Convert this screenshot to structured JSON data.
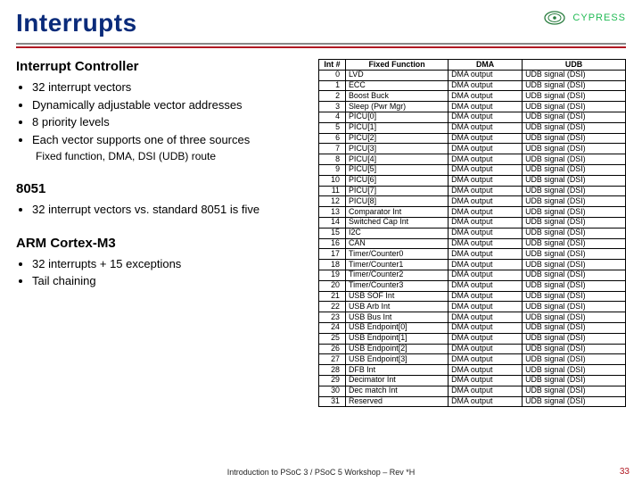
{
  "title": "Interrupts",
  "logo": {
    "company": "CYPRESS"
  },
  "sections": [
    {
      "heading": "Interrupt Controller",
      "bullets": [
        "32 interrupt vectors",
        "Dynamically adjustable vector addresses",
        "8 priority levels",
        "Each vector supports one of three sources"
      ],
      "sub": "Fixed function, DMA, DSI (UDB) route"
    },
    {
      "heading": "8051",
      "bullets": [
        "32 interrupt vectors vs. standard 8051 is five"
      ]
    },
    {
      "heading": "ARM Cortex-M3",
      "bullets": [
        "32 interrupts + 15 exceptions",
        "Tail chaining"
      ]
    }
  ],
  "table": {
    "headers": [
      "Int #",
      "Fixed Function",
      "DMA",
      "UDB"
    ],
    "rows": [
      [
        "0",
        "LVD",
        "DMA output",
        "UDB signal (DSI)"
      ],
      [
        "1",
        "ECC",
        "DMA output",
        "UDB signal (DSI)"
      ],
      [
        "2",
        "Boost Buck",
        "DMA output",
        "UDB signal (DSI)"
      ],
      [
        "3",
        "Sleep (Pwr Mgr)",
        "DMA output",
        "UDB signal (DSI)"
      ],
      [
        "4",
        "PICU[0]",
        "DMA output",
        "UDB signal (DSI)"
      ],
      [
        "5",
        "PICU[1]",
        "DMA output",
        "UDB signal (DSI)"
      ],
      [
        "6",
        "PICU[2]",
        "DMA output",
        "UDB signal (DSI)"
      ],
      [
        "7",
        "PICU[3]",
        "DMA output",
        "UDB signal (DSI)"
      ],
      [
        "8",
        "PICU[4]",
        "DMA output",
        "UDB signal (DSI)"
      ],
      [
        "9",
        "PICU[5]",
        "DMA output",
        "UDB signal (DSI)"
      ],
      [
        "10",
        "PICU[6]",
        "DMA output",
        "UDB signal (DSI)"
      ],
      [
        "11",
        "PICU[7]",
        "DMA output",
        "UDB signal (DSI)"
      ],
      [
        "12",
        "PICU[8]",
        "DMA output",
        "UDB signal (DSI)"
      ],
      [
        "13",
        "Comparator Int",
        "DMA output",
        "UDB signal (DSI)"
      ],
      [
        "14",
        "Switched Cap Int",
        "DMA output",
        "UDB signal (DSI)"
      ],
      [
        "15",
        "I2C",
        "DMA output",
        "UDB signal (DSI)"
      ],
      [
        "16",
        "CAN",
        "DMA output",
        "UDB signal (DSI)"
      ],
      [
        "17",
        "Timer/Counter0",
        "DMA output",
        "UDB signal (DSI)"
      ],
      [
        "18",
        "Timer/Counter1",
        "DMA output",
        "UDB signal (DSI)"
      ],
      [
        "19",
        "Timer/Counter2",
        "DMA output",
        "UDB signal (DSI)"
      ],
      [
        "20",
        "Timer/Counter3",
        "DMA output",
        "UDB signal (DSI)"
      ],
      [
        "21",
        "USB SOF Int",
        "DMA output",
        "UDB signal (DSI)"
      ],
      [
        "22",
        "USB Arb Int",
        "DMA output",
        "UDB signal (DSI)"
      ],
      [
        "23",
        "USB Bus Int",
        "DMA output",
        "UDB signal (DSI)"
      ],
      [
        "24",
        "USB Endpoint[0]",
        "DMA output",
        "UDB signal (DSI)"
      ],
      [
        "25",
        "USB Endpoint[1]",
        "DMA output",
        "UDB signal (DSI)"
      ],
      [
        "26",
        "USB Endpoint[2]",
        "DMA output",
        "UDB signal (DSI)"
      ],
      [
        "27",
        "USB Endpoint[3]",
        "DMA output",
        "UDB signal (DSI)"
      ],
      [
        "28",
        "DFB Int",
        "DMA output",
        "UDB signal (DSI)"
      ],
      [
        "29",
        "Decimator Int",
        "DMA output",
        "UDB signal (DSI)"
      ],
      [
        "30",
        "Dec match Int",
        "DMA output",
        "UDB signal (DSI)"
      ],
      [
        "31",
        "Reserved",
        "DMA output",
        "UDB signal (DSI)"
      ]
    ]
  },
  "footer": "Introduction to PSoC 3 / PSoC 5 Workshop – Rev *H",
  "pagenum": "33"
}
